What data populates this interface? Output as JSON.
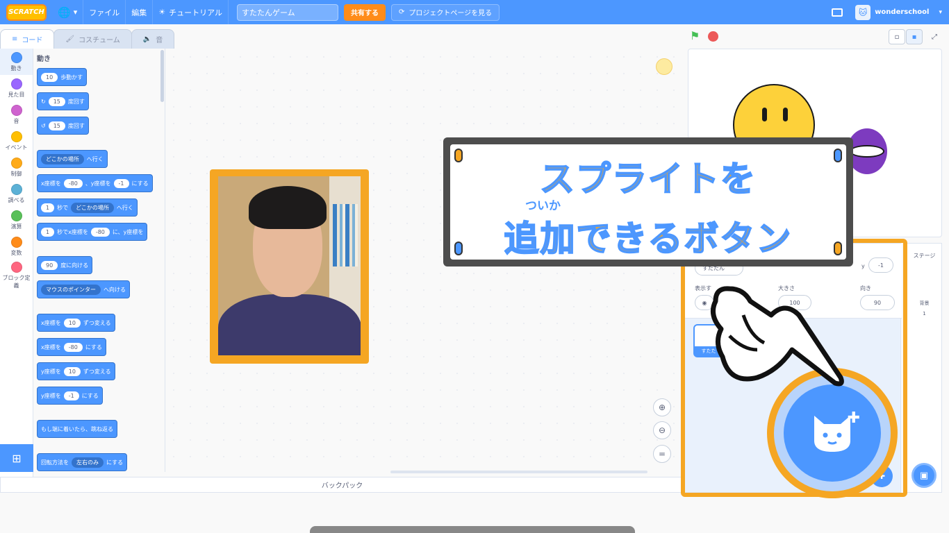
{
  "menubar": {
    "logo": "SCRATCH",
    "file": "ファイル",
    "edit": "編集",
    "tutorial": "チュートリアル",
    "project_title": "すたたんゲーム",
    "share": "共有する",
    "project_page": "プロジェクトページを見る",
    "username": "wonderschool"
  },
  "tabs": {
    "code": "コード",
    "costume": "コスチューム",
    "sound": "音"
  },
  "categories": [
    {
      "label": "動き",
      "color": "#4c97ff"
    },
    {
      "label": "見た目",
      "color": "#9966ff"
    },
    {
      "label": "音",
      "color": "#cf63cf"
    },
    {
      "label": "イベント",
      "color": "#ffbf00"
    },
    {
      "label": "制御",
      "color": "#ffab19"
    },
    {
      "label": "調べる",
      "color": "#5cb1d6"
    },
    {
      "label": "演算",
      "color": "#59c059"
    },
    {
      "label": "変数",
      "color": "#ff8c1a"
    },
    {
      "label": "ブロック定義",
      "color": "#ff6680"
    }
  ],
  "palette": {
    "title": "動き",
    "blocks": {
      "move": {
        "value": "10",
        "text": "歩動かす"
      },
      "turn_right": {
        "value": "15",
        "text": "度回す"
      },
      "turn_left": {
        "value": "15",
        "text": "度回す"
      },
      "goto": {
        "drop": "どこかの場所",
        "text": "へ行く"
      },
      "gotoxy": {
        "a": "x座標を",
        "x": "-80",
        "b": "、y座標を",
        "y": "-1",
        "c": "にする"
      },
      "glide": {
        "value": "1",
        "a": "秒で",
        "drop": "どこかの場所",
        "b": "へ行く"
      },
      "glidexy": {
        "value": "1",
        "a": "秒でx座標を",
        "x": "-80",
        "b": "に、y座標を"
      },
      "point": {
        "value": "90",
        "text": "度に向ける"
      },
      "pointto": {
        "drop": "マウスのポインター",
        "text": "へ向ける"
      },
      "changex": {
        "a": "x座標を",
        "value": "10",
        "b": "ずつ変える"
      },
      "setx": {
        "a": "x座標を",
        "value": "-80",
        "b": "にする"
      },
      "changey": {
        "a": "y座標を",
        "value": "10",
        "b": "ずつ変える"
      },
      "sety": {
        "a": "y座標を",
        "value": "-1",
        "b": "にする"
      },
      "bounce": {
        "text": "もし端に着いたら、跳ね返る"
      },
      "rotstyle": {
        "a": "回転方法を",
        "drop": "左右のみ",
        "b": "にする"
      }
    }
  },
  "banner": {
    "line1": "スプライトを",
    "ruby": "ついか",
    "line2": "追加できるボタン"
  },
  "sprite_info": {
    "sprite_name": "すたたん",
    "y_label": "y",
    "y_value": "-1",
    "show_label": "表示す",
    "size_label": "大きさ",
    "size_value": "100",
    "direction_label": "向き",
    "direction_value": "90",
    "thumb_name": "すたた"
  },
  "stage_pane": {
    "title": "ステージ",
    "backdrops_label": "背景",
    "backdrops_count": "1"
  },
  "backpack": "バックパック"
}
